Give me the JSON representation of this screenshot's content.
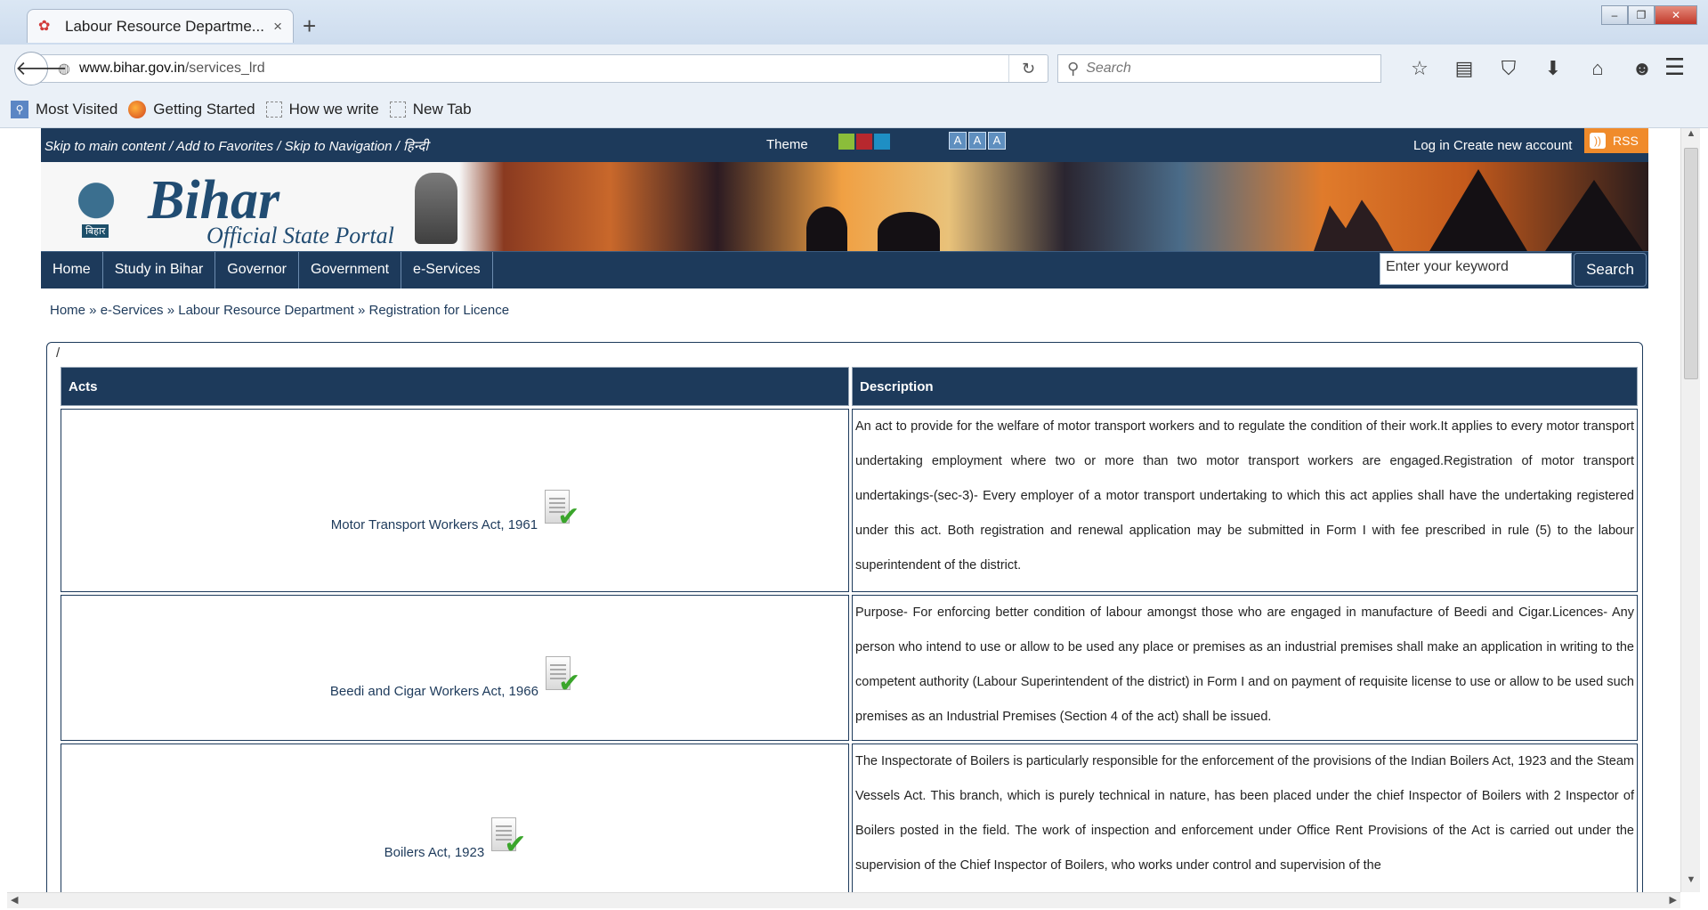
{
  "browser": {
    "tab_title": "Labour Resource Departme...",
    "tab_close": "×",
    "new_tab": "+",
    "url_host": "www.bihar.gov.in",
    "url_path": "/services_lrd",
    "search_placeholder": "Search",
    "bookmarks": [
      "Most Visited",
      "Getting Started",
      "How we write",
      "New Tab"
    ],
    "toolbar_icons": [
      "star-icon",
      "reading-list-icon",
      "pocket-icon",
      "download-icon",
      "home-icon",
      "chat-icon"
    ],
    "window_buttons": [
      "minimize",
      "restore",
      "close"
    ]
  },
  "site": {
    "skip_links": "Skip to main content / Add to Favorites / Skip to Navigation / हिन्दी",
    "theme_label": "Theme",
    "theme_colors": [
      "#8bbd3a",
      "#b7282e",
      "#1e8fc4"
    ],
    "font_sizes": [
      "A",
      "A",
      "A"
    ],
    "login": "Log in",
    "create_account": "Create new account",
    "rss": "RSS",
    "logo_title": "Bihar",
    "logo_subtitle": "Official State Portal",
    "logo_tag": "बिहार",
    "nav": [
      "Home",
      "Study in Bihar",
      "Governor",
      "Government",
      "e-Services"
    ],
    "keyword_placeholder": "Enter your keyword",
    "search_button": "Search",
    "breadcrumb": "Home » e-Services » Labour Resource Department » Registration for Licence",
    "box_marker": "/"
  },
  "table": {
    "headers": [
      "Acts",
      "Description"
    ],
    "rows": [
      {
        "act": "Motor Transport Workers Act, 1961",
        "description": "An act to provide for the welfare of motor transport workers and to regulate the condition of their work.It applies to every motor transport undertaking employment where two or more than two motor transport workers are engaged.Registration of motor transport undertakings-(sec-3)- Every employer of a motor transport undertaking to which this act applies shall have the undertaking registered under this act. Both registration and renewal application may be submitted in Form I with fee prescribed in rule (5) to the labour superintendent of the district."
      },
      {
        "act": "Beedi and Cigar Workers Act, 1966",
        "description": "Purpose- For enforcing better condition of labour amongst those who are engaged in manufacture of Beedi and Cigar.Licences- Any person who intend to use or allow to be used any place or premises as an industrial premises shall make an application in writing to the competent authority (Labour Superintendent of the district) in Form I and on payment of requisite license to use or allow to be used such premises as an Industrial Premises (Section 4 of the act) shall be issued."
      },
      {
        "act": "Boilers Act, 1923",
        "description": "The Inspectorate of Boilers is particularly responsible for the enforcement of the provisions of the Indian Boilers Act, 1923 and the Steam Vessels Act. This branch, which is purely technical in nature, has been placed under the chief Inspector of Boilers with 2 Inspector of Boilers posted in the field. The work of inspection and enforcement under Office Rent Provisions of the Act is carried out under the supervision of the Chief Inspector of Boilers, who works under control and supervision of the"
      }
    ]
  }
}
